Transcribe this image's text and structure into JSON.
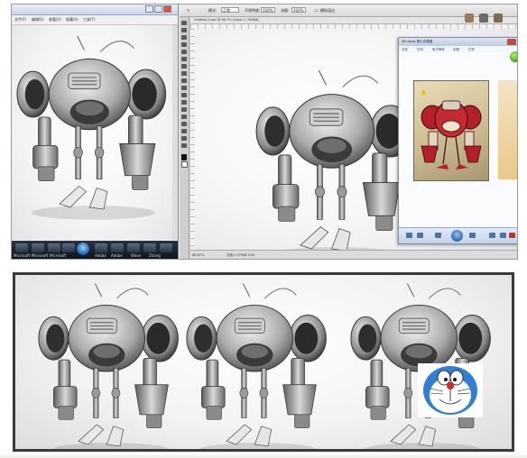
{
  "left_window": {
    "menu_items": [
      "文件(F)",
      "编辑(E)",
      "查看(V)",
      "收藏(A)",
      "工具(T)",
      "帮助(H)"
    ],
    "taskbar_labels": [
      "Microsoft",
      "Microsoft",
      "Microsoft",
      "Microsoft",
      "Adobe",
      "Adobe",
      "Wave",
      "Zhang"
    ]
  },
  "photoshop": {
    "options_labels": [
      "模式:",
      "正常",
      "不透明度:",
      "100%",
      "流量:",
      "100%",
      "模拟湿边"
    ],
    "doc_tab": "Untitled-1.psd @ 66.7% (Layer 1, RGB/8)",
    "status_left": "66.67%",
    "status_doc": "文档:1.37M/8.21M"
  },
  "photo_viewer": {
    "title": "Windows 照片查看器",
    "menu_items": [
      "文件",
      "打印",
      "电子邮件",
      "刻录",
      "打开"
    ]
  },
  "colors": {
    "accent_red": "#b3202a",
    "taskbar": "#1c2430",
    "frame": "#3a3a3a"
  },
  "icons": [
    "robot-render",
    "doraemon-sticker",
    "start-orb",
    "green-badge"
  ]
}
